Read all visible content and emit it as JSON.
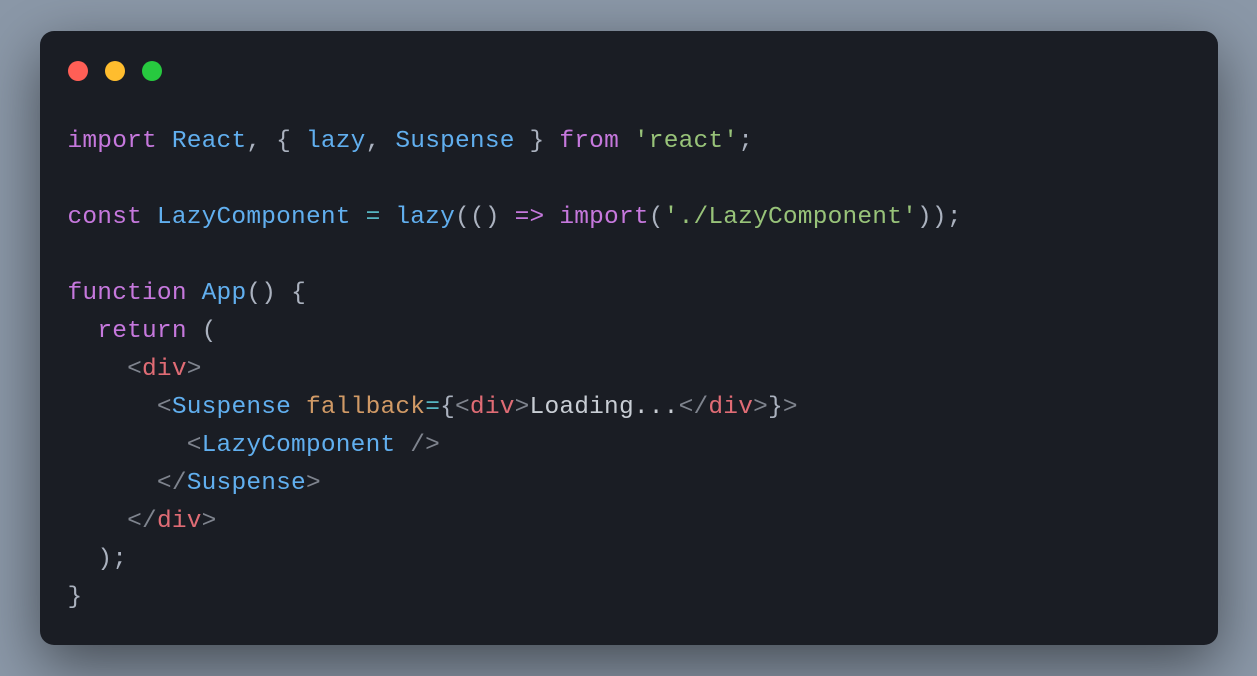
{
  "traffic": {
    "red": "#ff5f56",
    "yellow": "#ffbd2e",
    "green": "#27c93f"
  },
  "l1": {
    "import": "import",
    "sp1": " ",
    "React": "React",
    "comma1": ",",
    "sp2": " ",
    "lbrace": "{",
    "sp3": " ",
    "lazy": "lazy",
    "comma2": ",",
    "sp4": " ",
    "Suspense": "Suspense",
    "sp5": " ",
    "rbrace": "}",
    "sp6": " ",
    "from": "from",
    "sp7": " ",
    "react_str": "'react'",
    "semi": ";"
  },
  "l3": {
    "const": "const",
    "sp1": " ",
    "Lazy": "LazyComponent",
    "sp2": " ",
    "eq": "=",
    "sp3": " ",
    "lazy": "lazy",
    "call_open": "((",
    "rparen0": ")",
    "sp4": " ",
    "arrow": "=>",
    "sp5": " ",
    "import_kw": "import",
    "lparen2": "(",
    "path": "'./LazyComponent'",
    "rparen1": ")",
    "rparen2": ")",
    "semi": ";"
  },
  "l5": {
    "function": "function",
    "sp1": " ",
    "App": "App",
    "parens": "()",
    "sp2": " ",
    "lbrace": "{"
  },
  "l6": {
    "indent": "  ",
    "return": "return",
    "sp": " ",
    "lparen": "("
  },
  "l7": {
    "indent": "    ",
    "lt": "<",
    "div": "div",
    "gt": ">"
  },
  "l8": {
    "indent": "      ",
    "lt": "<",
    "Suspense": "Suspense",
    "sp1": " ",
    "fallback": "fallback",
    "eq": "=",
    "lbrace": "{",
    "lt2": "<",
    "div": "div",
    "gt2": ">",
    "Loading": "Loading...",
    "lt3": "</",
    "div2": "div",
    "gt3": ">",
    "rbrace": "}",
    "gt": ">"
  },
  "l9": {
    "indent": "        ",
    "lt": "<",
    "Lazy": "LazyComponent",
    "sp": " ",
    "slashgt": "/>"
  },
  "l10": {
    "indent": "      ",
    "lt": "</",
    "Suspense": "Suspense",
    "gt": ">"
  },
  "l11": {
    "indent": "    ",
    "lt": "</",
    "div": "div",
    "gt": ">"
  },
  "l12": {
    "indent": "  ",
    "rparen": ")",
    "semi": ";"
  },
  "l13": {
    "rbrace": "}"
  }
}
